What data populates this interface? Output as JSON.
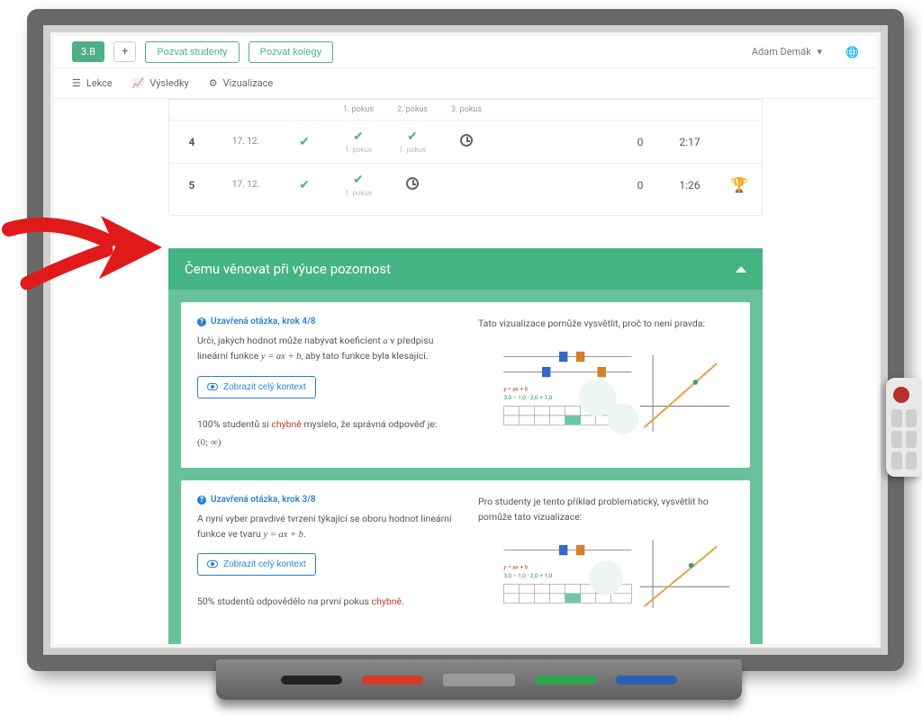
{
  "header": {
    "class_label": "3.B",
    "plus_label": "+",
    "invite_students": "Pozvat studenty",
    "invite_colleagues": "Pozvat kolegy",
    "user_name": "Adam Demák"
  },
  "tabs": {
    "lessons": "Lekce",
    "results": "Výsledky",
    "visualization": "Vizualizace"
  },
  "table": {
    "attempt_labels": [
      "1. pokus",
      "2. pokus",
      "3. pokus"
    ],
    "rows": [
      {
        "n": "4",
        "date": "17. 12.",
        "attempts": [
          "check",
          "check",
          "check"
        ],
        "sub_labels": [
          "1. pokus",
          "1. pokus",
          ""
        ],
        "last_icon": "clock",
        "score": "0",
        "time": "2:17",
        "trophy": false
      },
      {
        "n": "5",
        "date": "17. 12.",
        "attempts": [
          "check",
          "check",
          ""
        ],
        "sub_labels": [
          "1. pokus",
          "",
          ""
        ],
        "last_icon": "clock",
        "score": "0",
        "time": "1:26",
        "trophy": true
      }
    ]
  },
  "attention": {
    "title": "Čemu věnovat při výuce pozornost",
    "items": [
      {
        "label": "Uzavřená otázka, krok 4/8",
        "question_pre": "Urči, jakých hodnot může nabývat koeficient ",
        "question_var": "a",
        "question_mid": " v předpisu lineární funkce ",
        "question_formula": "y = ax + b",
        "question_post": ", aby tato funkce byla klesající.",
        "context_btn": "Zobrazit celý kontext",
        "stats_pre": "100% studentů si ",
        "stats_err": "chybně",
        "stats_post": " myslelo, že správná odpověď je:",
        "answer": "(0; ∞)",
        "right_text": "Tato vizualizace pomůže vysvětlit, proč to není pravda:",
        "viz_formula1": "y = ax + b",
        "viz_formula2": "3,0 − 1,0 · 2,0 + 1,0"
      },
      {
        "label": "Uzavřená otázka, krok 3/8",
        "question_pre": "A nyní vyber pravdivé tvrzení týkající se oboru hodnot lineární funkce ve tvaru ",
        "question_formula": "y = ax + b",
        "question_post": ".",
        "context_btn": "Zobrazit celý kontext",
        "stats_pre": "50% studentů odpovědělo na první pokus ",
        "stats_err": "chybně",
        "stats_post": ".",
        "right_text": "Pro studenty je tento příklad problematický, vysvětlit ho pomůže tato vizualizace:",
        "viz_formula1": "y = ax + b",
        "viz_formula2": "3,0 − 1,0 · 2,0 + 1,0"
      }
    ]
  }
}
